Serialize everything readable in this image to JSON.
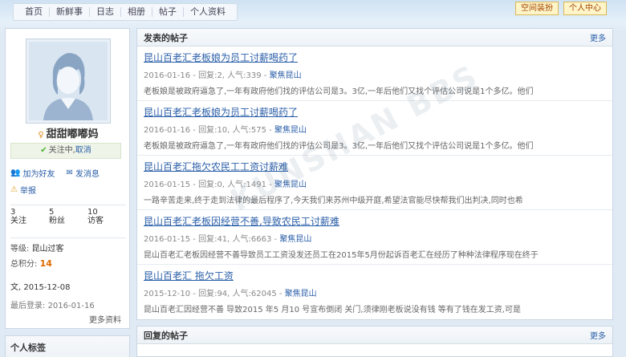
{
  "nav": {
    "items": [
      "首页",
      "新鲜事",
      "日志",
      "相册",
      "帖子",
      "个人资料"
    ]
  },
  "toplinks": {
    "space_label": "空间装扮",
    "center_label": "个人中心"
  },
  "profile": {
    "username": "甜甜嘟嘟妈",
    "follow_text": "关注中,",
    "cancel_label": "取消",
    "add_friend": "加为好友",
    "send_msg": "发消息",
    "report": "举报",
    "stats": [
      {
        "value": "3",
        "label": "关注"
      },
      {
        "value": "5",
        "label": "粉丝"
      },
      {
        "value": "10",
        "label": "访客"
      }
    ],
    "level_label": "等级:",
    "level_value": "昆山过客",
    "points_label": "总积分:",
    "points_value": "14",
    "join_label": "文,",
    "join_value": "2015-12-08",
    "last_login_label": "最后登录:",
    "last_login_value": "2016-01-16",
    "more_label": "更多资料",
    "tags_title": "个人标签"
  },
  "posts_panel": {
    "title": "发表的帖子",
    "more": "更多",
    "posts": [
      {
        "title": "昆山百老汇老板娘为员工讨薪喝药了",
        "meta": "2016-01-16 - 回复:2, 人气:339 - ",
        "loc": "聚焦昆山",
        "excerpt": "老板娘是被政府逼急了,一年有政府他们找的评估公司是3。3亿,一年后他们又找个评估公司说是1个多亿。他们"
      },
      {
        "title": "昆山百老汇老板娘为员工讨薪喝药了",
        "meta": "2016-01-16 - 回复:10, 人气:575 - ",
        "loc": "聚焦昆山",
        "excerpt": "老板娘是被政府逼急了,一年有政府他们找的评估公司是3。3亿,一年后他们又找个评估公司说是1个多亿。他们"
      },
      {
        "title": "昆山百老汇拖欠农民工工资讨薪难",
        "meta": "2016-01-15 - 回复:0, 人气:1491 - ",
        "loc": "聚焦昆山",
        "excerpt": "一路辛苦走来,终于走到法律的最后程序了,今天我们来苏州中级开庭,希望法官能尽快帮我们出判决,同时也希"
      },
      {
        "title": "昆山百老汇老板因经营不善,导致农民工讨薪难",
        "meta": "2016-01-15 - 回复:41, 人气:6663 - ",
        "loc": "聚焦昆山",
        "excerpt": "昆山百老汇老板因经营不善导致员工工资没发还员工在2015年5月份起诉百老汇在经历了种种法律程序现在终于"
      },
      {
        "title": "昆山百老汇 拖欠工资",
        "meta": "2015-12-10 - 回复:94, 人气:62045 - ",
        "loc": "聚焦昆山",
        "excerpt": "昆山百老汇因经营不善 导致2015 年5 月10 号宣布倒闭 关门,须律刚老板说没有钱 等有了钱在发工资,可是"
      }
    ]
  },
  "replies_panel": {
    "title": "回复的帖子",
    "more": "更多"
  },
  "watermark": "KUNSHAN BBS"
}
